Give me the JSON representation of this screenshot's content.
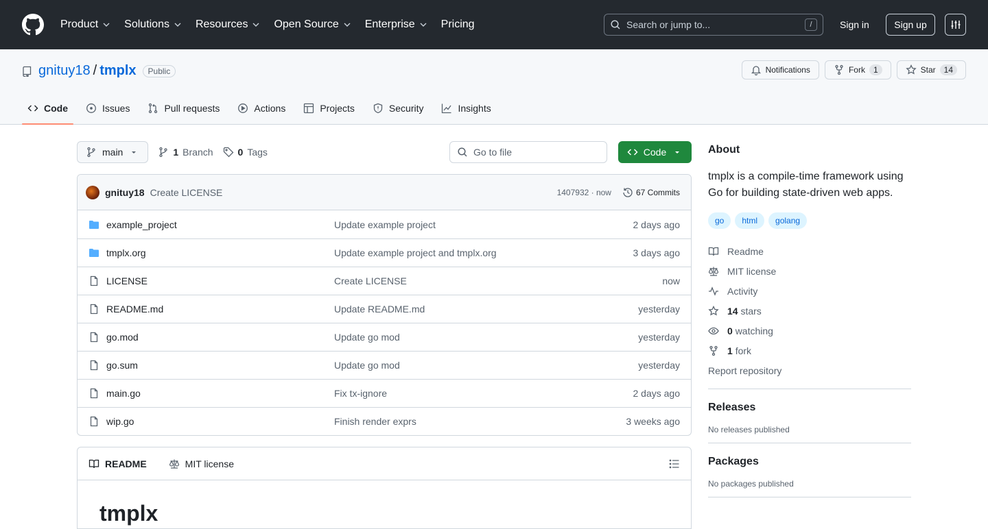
{
  "topnav": {
    "items": [
      "Product",
      "Solutions",
      "Resources",
      "Open Source",
      "Enterprise",
      "Pricing"
    ],
    "search_placeholder": "Search or jump to...",
    "search_shortcut": "/",
    "sign_in": "Sign in",
    "sign_up": "Sign up"
  },
  "repo": {
    "owner": "gnituy18",
    "sep": "/",
    "name": "tmplx",
    "visibility": "Public",
    "notifications_label": "Notifications",
    "fork_label": "Fork",
    "fork_count": "1",
    "star_label": "Star",
    "star_count": "14"
  },
  "tabs": [
    {
      "label": "Code",
      "icon": "code-icon",
      "active": true
    },
    {
      "label": "Issues",
      "icon": "issue-icon",
      "active": false
    },
    {
      "label": "Pull requests",
      "icon": "pull-request-icon",
      "active": false
    },
    {
      "label": "Actions",
      "icon": "play-icon",
      "active": false
    },
    {
      "label": "Projects",
      "icon": "table-icon",
      "active": false
    },
    {
      "label": "Security",
      "icon": "shield-icon",
      "active": false
    },
    {
      "label": "Insights",
      "icon": "graph-icon",
      "active": false
    }
  ],
  "toolbar": {
    "branch": "main",
    "branch_count": "1",
    "branch_label": "Branch",
    "tag_count": "0",
    "tag_label": "Tags",
    "go_to_file": "Go to file",
    "code_button": "Code"
  },
  "commit": {
    "user": "gnituy18",
    "message": "Create LICENSE",
    "hash_time": "1407932 · now",
    "commits": "67 Commits"
  },
  "files": [
    {
      "name": "example_project",
      "type": "folder",
      "message": "Update example project",
      "age": "2 days ago"
    },
    {
      "name": "tmplx.org",
      "type": "folder",
      "message": "Update example project and tmplx.org",
      "age": "3 days ago"
    },
    {
      "name": "LICENSE",
      "type": "file",
      "message": "Create LICENSE",
      "age": "now"
    },
    {
      "name": "README.md",
      "type": "file",
      "message": "Update README.md",
      "age": "yesterday"
    },
    {
      "name": "go.mod",
      "type": "file",
      "message": "Update go mod",
      "age": "yesterday"
    },
    {
      "name": "go.sum",
      "type": "file",
      "message": "Update go mod",
      "age": "yesterday"
    },
    {
      "name": "main.go",
      "type": "file",
      "message": "Fix tx-ignore",
      "age": "2 days ago"
    },
    {
      "name": "wip.go",
      "type": "file",
      "message": "Finish render exprs",
      "age": "3 weeks ago"
    }
  ],
  "readme": {
    "tab_readme": "README",
    "tab_license": "MIT license",
    "heading": "tmplx"
  },
  "about": {
    "title": "About",
    "description": "tmplx is a compile-time framework using Go for building state-driven web apps.",
    "topics": [
      "go",
      "html",
      "golang"
    ],
    "readme": "Readme",
    "license": "MIT license",
    "activity": "Activity",
    "stars_count": "14",
    "stars_label": "stars",
    "watching_count": "0",
    "watching_label": "watching",
    "forks_count": "1",
    "forks_label": "fork",
    "report": "Report repository"
  },
  "releases": {
    "title": "Releases",
    "text": "No releases published"
  },
  "packages": {
    "title": "Packages",
    "text": "No packages published"
  },
  "colors": {
    "header_bg": "#24292f",
    "link": "#0969da",
    "code_button": "#1f883d",
    "tab_underline": "#fd8c73"
  }
}
